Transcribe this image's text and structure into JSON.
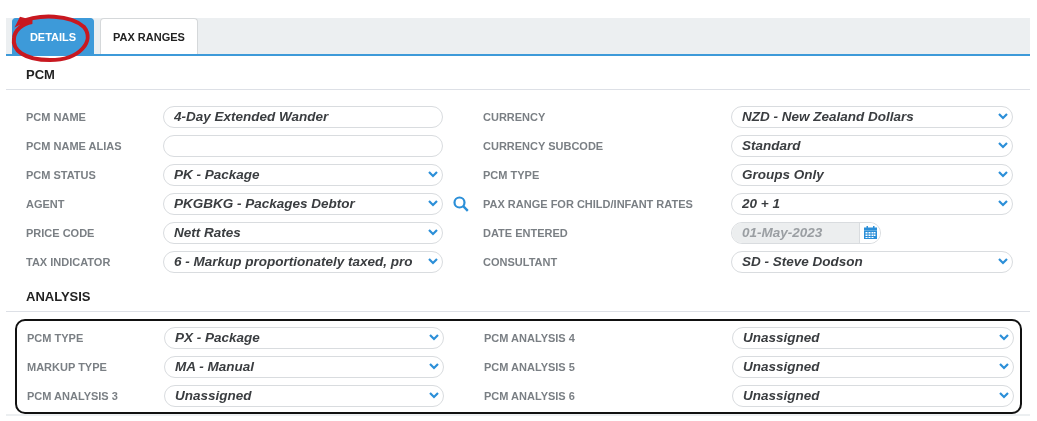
{
  "tabs": [
    {
      "label": "DETAILS",
      "selected": true,
      "circled": true
    },
    {
      "label": "PAX RANGES",
      "selected": false,
      "circled": false
    }
  ],
  "pcm": {
    "title": "PCM",
    "rows": [
      {
        "left": {
          "label": "PCM NAME",
          "kind": "text",
          "value": "4-Day Extended Wander"
        },
        "search": false,
        "right": {
          "label": "CURRENCY",
          "kind": "select",
          "value": "NZD - New Zealand Dollars"
        }
      },
      {
        "left": {
          "label": "PCM NAME ALIAS",
          "kind": "text"
        },
        "search": false,
        "right": {
          "label": "CURRENCY SUBCODE",
          "kind": "select",
          "value": "Standard"
        }
      },
      {
        "left": {
          "label": "PCM STATUS",
          "kind": "select",
          "value": "PK - Package"
        },
        "search": false,
        "right": {
          "label": "PCM TYPE",
          "kind": "select",
          "value": "Groups Only"
        }
      },
      {
        "left": {
          "label": "AGENT",
          "kind": "select",
          "value": "PKGBKG - Packages Debtor"
        },
        "search": true,
        "right": {
          "label": "PAX RANGE FOR CHILD/INFANT RATES",
          "kind": "select",
          "value": "20 + 1"
        }
      },
      {
        "left": {
          "label": "PRICE CODE",
          "kind": "select",
          "value": "Nett Rates"
        },
        "search": false,
        "right": {
          "label": "DATE ENTERED",
          "kind": "date",
          "value": "01-May-2023",
          "disabled": true
        }
      },
      {
        "left": {
          "label": "TAX INDICATOR",
          "kind": "select",
          "value": "6 - Markup proportionately taxed, pro"
        },
        "search": false,
        "right": {
          "label": "CONSULTANT",
          "kind": "select",
          "value": "SD - Steve Dodson"
        }
      }
    ]
  },
  "analysis": {
    "title": "ANALYSIS",
    "outlined": true,
    "rows": [
      {
        "left": {
          "label": "PCM TYPE",
          "kind": "select",
          "value": "PX - Package"
        },
        "right": {
          "label": "PCM ANALYSIS 4",
          "kind": "select",
          "value": "Unassigned"
        }
      },
      {
        "left": {
          "label": "MARKUP TYPE",
          "kind": "select",
          "value": "MA - Manual"
        },
        "right": {
          "label": "PCM ANALYSIS 5",
          "kind": "select",
          "value": "Unassigned"
        }
      },
      {
        "left": {
          "label": "PCM ANALYSIS 3",
          "kind": "select",
          "value": "Unassigned"
        },
        "right": {
          "label": "PCM ANALYSIS 6",
          "kind": "select",
          "value": "Unassigned"
        }
      }
    ]
  }
}
